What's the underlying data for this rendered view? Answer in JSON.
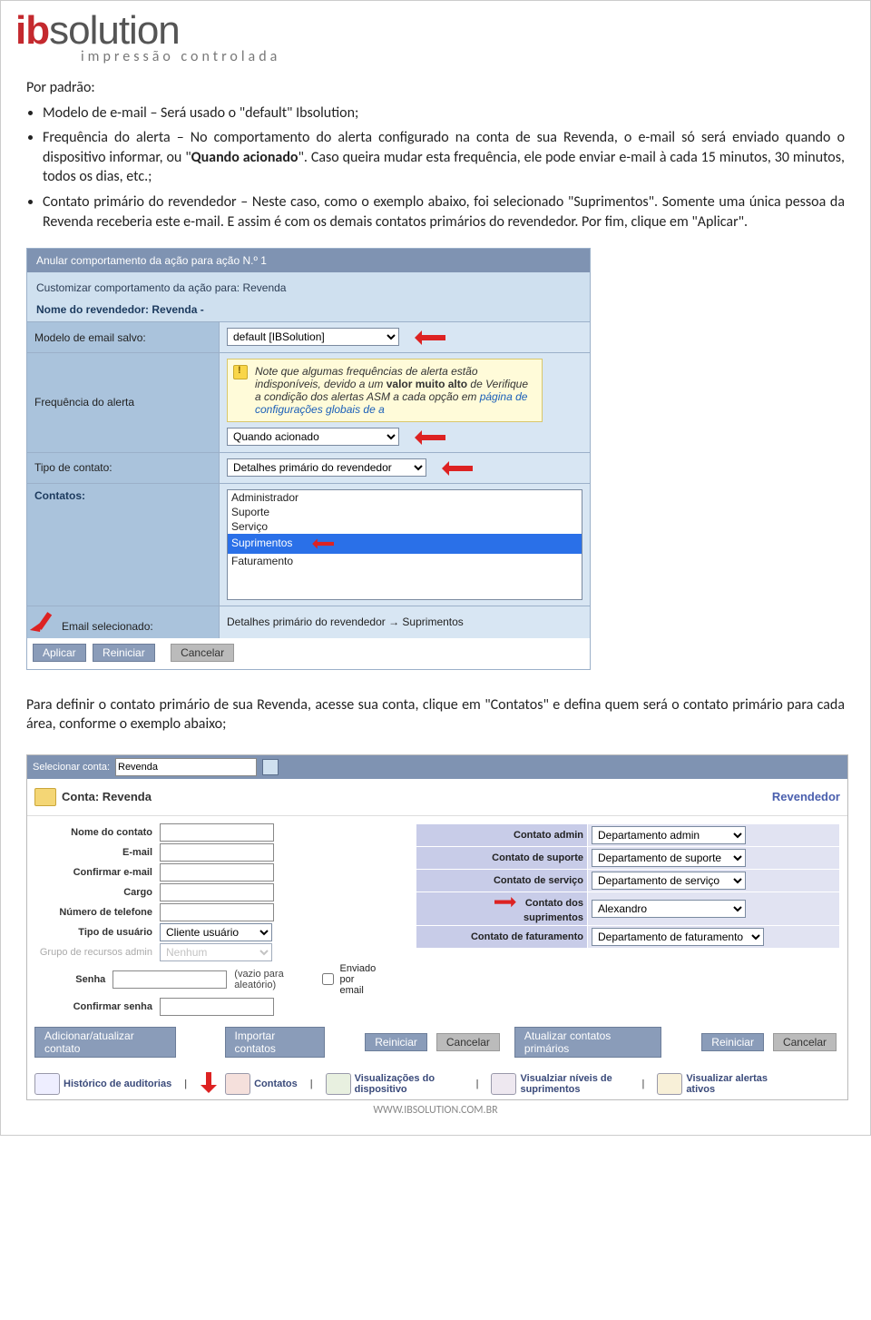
{
  "logo": {
    "ib": "ib",
    "solution": "solution",
    "tagline": "impressão controlada"
  },
  "text": {
    "por_padrao": "Por padrão:",
    "bullet1": "Modelo de e-mail – Será usado o \"default\" Ibsolution;",
    "bullet2a": "Frequência do alerta – No comportamento do alerta configurado na conta de sua Revenda, o e-mail só será enviado quando o dispositivo informar, ou \"",
    "bullet2bold": "Quando acionado",
    "bullet2b": "\". Caso queira mudar esta frequência, ele pode enviar e-mail à cada 15 minutos, 30 minutos, todos os dias, etc.;",
    "bullet3": "Contato primário do revendedor – Neste caso, como o exemplo abaixo, foi selecionado \"Suprimentos\". Somente uma única pessoa da Revenda receberia este e-mail. E assim é com os demais contatos primários do revendedor. Por fim, clique em \"Aplicar\".",
    "para2": "Para definir o contato primário de sua Revenda, acesse sua conta, clique em \"Contatos\" e defina quem será o contato primário para cada área, conforme o exemplo abaixo;"
  },
  "panel1": {
    "titlebar": "Anular comportamento da ação para ação N.º 1",
    "subtitle": "Customizar comportamento da ação para: Revenda",
    "reseller_label": "Nome do revendedor: Revenda -",
    "rows": {
      "model_label": "Modelo de email salvo:",
      "model_value": "default [IBSolution]",
      "freq_label": "Frequência do alerta",
      "note_lead": "Note que algumas frequências de alerta estão ",
      "note_ital1": "indisponíveis",
      "note_mid": ", devido a um ",
      "note_strong": "valor muito alto",
      "note_mid2": " de Verifique a condição dos alertas ASM a cada opção em ",
      "note_link": "página de configurações globais de a",
      "freq_value": "Quando acionado",
      "type_label": "Tipo de contato:",
      "type_value": "Detalhes primário do revendedor",
      "contacts_label": "Contatos:",
      "listbox": [
        "Administrador",
        "Suporte",
        "Serviço",
        "Suprimentos",
        "Faturamento"
      ],
      "email_label": "Email selecionado:",
      "email_value": "Detalhes primário do revendedor → Suprimentos"
    },
    "buttons": {
      "apply": "Aplicar",
      "reset": "Reiniciar",
      "cancel": "Cancelar"
    }
  },
  "panel2": {
    "selbar_label": "Selecionar conta:",
    "selbar_value": "Revenda",
    "account_label": "Conta: Revenda",
    "account_role": "Revendedor",
    "left": {
      "nome": "Nome do contato",
      "email": "E-mail",
      "confirm_email": "Confirmar e-mail",
      "cargo": "Cargo",
      "telefone": "Número de telefone",
      "tipo_usuario": "Tipo de usuário",
      "tipo_usuario_val": "Cliente usuário",
      "grupo": "Grupo de recursos admin",
      "grupo_val": "Nenhum",
      "senha": "Senha",
      "senha_note": "(vazio para aleatório)",
      "senha_chk": "Enviado por email",
      "confirm_senha": "Confirmar senha"
    },
    "right": {
      "admin_l": "Contato admin",
      "admin_v": "Departamento admin",
      "sup_l": "Contato de suporte",
      "sup_v": "Departamento de suporte",
      "serv_l": "Contato de serviço",
      "serv_v": "Departamento de serviço",
      "supr_l": "Contato dos suprimentos",
      "supr_v": "Alexandro",
      "fat_l": "Contato de faturamento",
      "fat_v": "Departamento de faturamento"
    },
    "buttons": {
      "add": "Adicionar/atualizar contato",
      "import": "Importar contatos",
      "reset": "Reiniciar",
      "cancel": "Cancelar",
      "update": "Atualizar contatos primários",
      "reset2": "Reiniciar",
      "cancel2": "Cancelar"
    },
    "footnav": {
      "aud": "Histórico de auditorias",
      "con": "Contatos",
      "dev": "Visualizações do dispositivo",
      "sup": "Visualziar níveis de suprimentos",
      "ale": "Visualizar alertas ativos"
    }
  },
  "footer_url": "WWW.IBSOLUTION.COM.BR"
}
